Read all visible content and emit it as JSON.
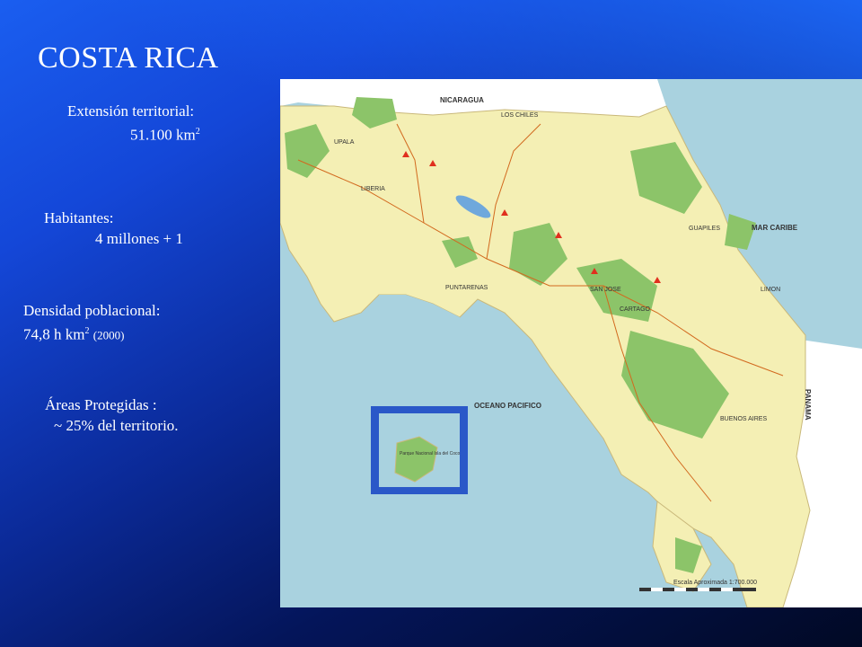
{
  "slide": {
    "title": "COSTA RICA",
    "colors": {
      "background_top": "#1a5ef0",
      "background_bottom": "#010924"
    }
  },
  "stats": {
    "extension_label": "Extensión territorial:",
    "extension_value": "51.100 km",
    "extension_unit_sup": "2",
    "habitants_label": "Habitantes:",
    "habitants_value": "4 millones + 1",
    "density_label": "Densidad poblacional:",
    "density_value": "74,8 h km",
    "density_unit_sup": "2",
    "density_year": "(2000)",
    "protected_label": "Áreas Protegidas :",
    "protected_value": "~ 25% del territorio."
  },
  "map": {
    "labels": {
      "nicaragua": "NICARAGUA",
      "mar_caribe": "MAR CARIBE",
      "oceano_pacifico": "OCEANO PACIFICO",
      "panama": "PANAMA",
      "los_chiles": "LOS CHILES",
      "liberia": "LIBERIA",
      "puntarenas": "PUNTARENAS",
      "san_jose": "SAN JOSE",
      "cartago": "CARTAGO",
      "limon": "LIMON",
      "buenos_aires": "BUENOS AIRES",
      "upala": "UPALA",
      "guapiles": "GUAPILES",
      "scale": "Escala Aproximada 1:700.000",
      "inset_title": "Parque Nacional Isla del Coco"
    },
    "colors": {
      "sea": "#a9d2df",
      "land": "#f4efb4",
      "parks": "#8cc469",
      "neighbors": "#ffffff"
    }
  }
}
